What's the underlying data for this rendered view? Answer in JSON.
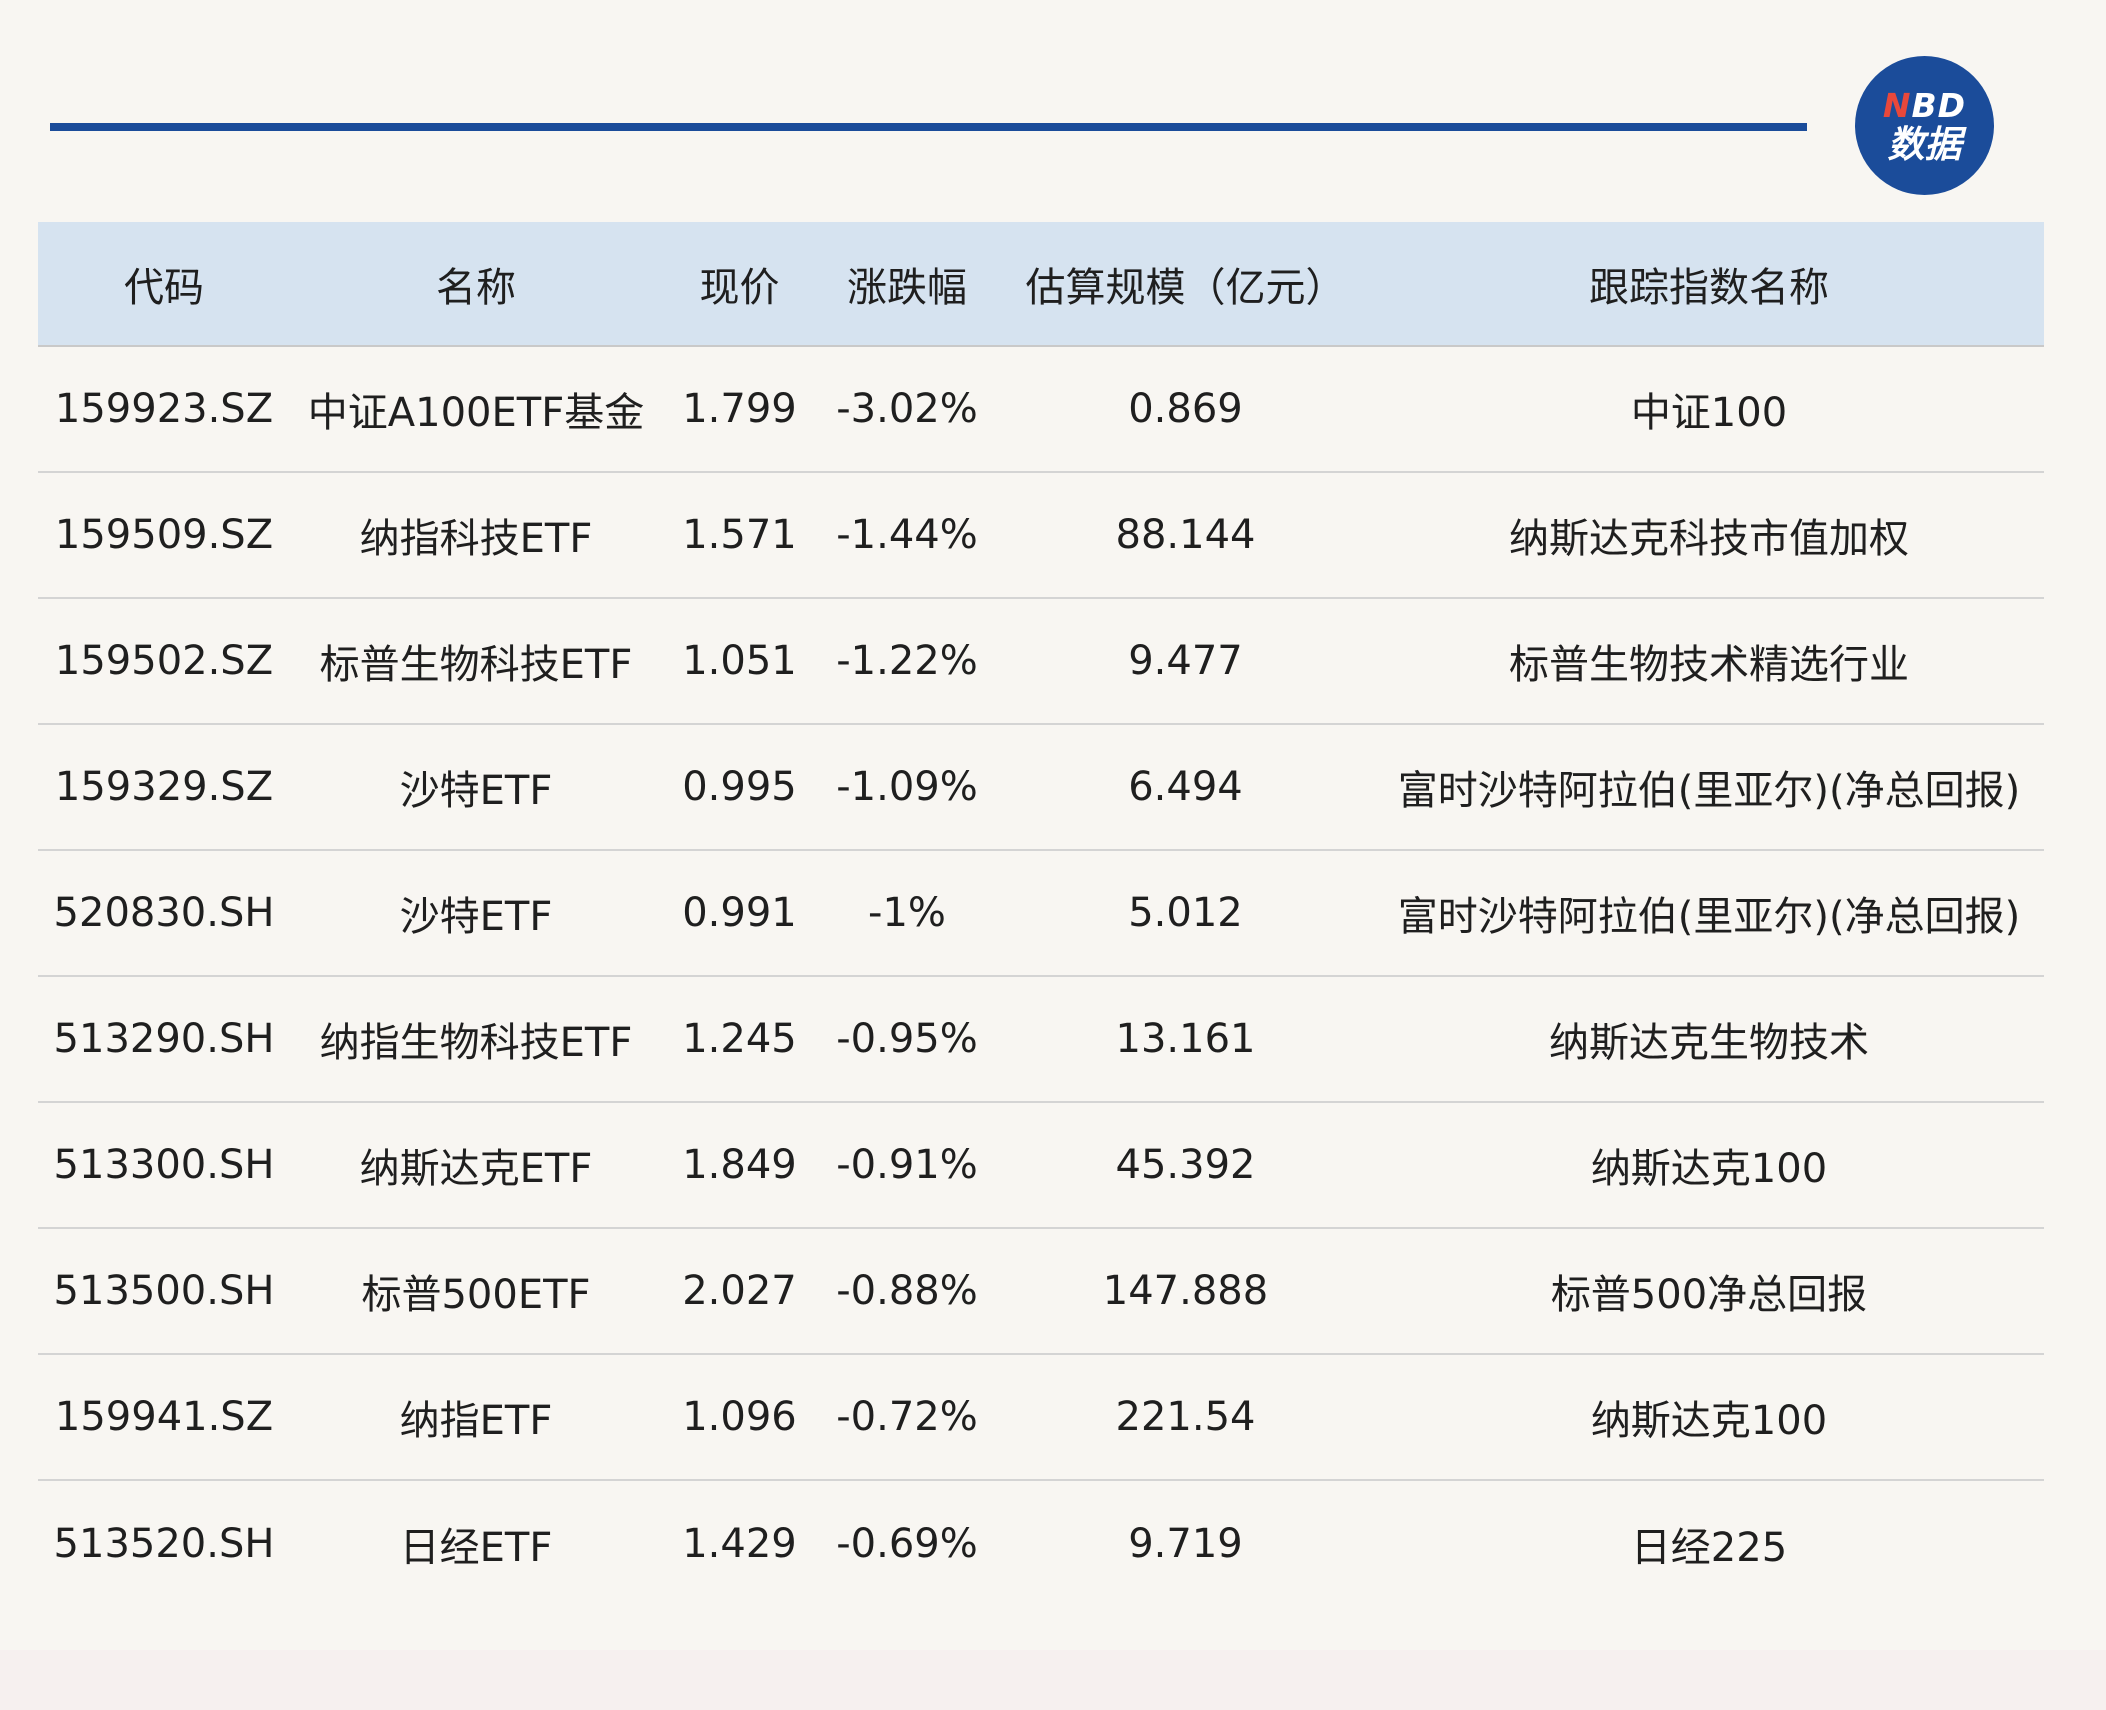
{
  "brand": {
    "logo_top": "NBD",
    "logo_bottom": "数据",
    "accent_color": "#1b4c9a",
    "logo_n_color": "#e8483b"
  },
  "table": {
    "headers": [
      "代码",
      "名称",
      "现价",
      "涨跌幅",
      "估算规模（亿元）",
      "跟踪指数名称"
    ],
    "rows": [
      [
        "159923.SZ",
        "中证A100ETF基金",
        "1.799",
        "-3.02%",
        "0.869",
        "中证100"
      ],
      [
        "159509.SZ",
        "纳指科技ETF",
        "1.571",
        "-1.44%",
        "88.144",
        "纳斯达克科技市值加权"
      ],
      [
        "159502.SZ",
        "标普生物科技ETF",
        "1.051",
        "-1.22%",
        "9.477",
        "标普生物技术精选行业"
      ],
      [
        "159329.SZ",
        "沙特ETF",
        "0.995",
        "-1.09%",
        "6.494",
        "富时沙特阿拉伯(里亚尔)(净总回报)"
      ],
      [
        "520830.SH",
        "沙特ETF",
        "0.991",
        "-1%",
        "5.012",
        "富时沙特阿拉伯(里亚尔)(净总回报)"
      ],
      [
        "513290.SH",
        "纳指生物科技ETF",
        "1.245",
        "-0.95%",
        "13.161",
        "纳斯达克生物技术"
      ],
      [
        "513300.SH",
        "纳斯达克ETF",
        "1.849",
        "-0.91%",
        "45.392",
        "纳斯达克100"
      ],
      [
        "513500.SH",
        "标普500ETF",
        "2.027",
        "-0.88%",
        "147.888",
        "标普500净总回报"
      ],
      [
        "159941.SZ",
        "纳指ETF",
        "1.096",
        "-0.72%",
        "221.54",
        "纳斯达克100"
      ],
      [
        "513520.SH",
        "日经ETF",
        "1.429",
        "-0.69%",
        "9.719",
        "日经225"
      ]
    ]
  }
}
